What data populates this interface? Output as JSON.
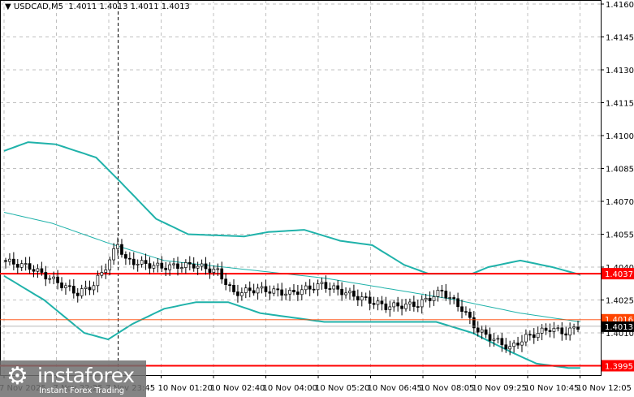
{
  "header": {
    "symbol": "USDCAD,M5",
    "ohlc": "1.4011 1.4013 1.4011 1.4013"
  },
  "watermark": {
    "brand": "instaforex",
    "tagline": "Instant Forex Trading"
  },
  "chart_data": {
    "type": "candlestick",
    "title": "USDCAD,M5",
    "ylim": [
      1.399,
      1.416
    ],
    "yticks": [
      "1.4160",
      "1.4145",
      "1.4130",
      "1.4115",
      "1.4100",
      "1.4085",
      "1.4070",
      "1.4055",
      "1.4040",
      "1.4025",
      "1.4010"
    ],
    "xticks": [
      "7 Nov 2025",
      "7 Nov 22:25",
      "7 Nov 23:45",
      "10 Nov 01:20",
      "10 Nov 02:40",
      "10 Nov 04:00",
      "10 Nov 05:20",
      "10 Nov 06:45",
      "10 Nov 08:05",
      "10 Nov 09:25",
      "10 Nov 10:45",
      "10 Nov 12:05"
    ],
    "bars": 144,
    "price": [
      [
        0,
        1.4043
      ],
      [
        7,
        1.404
      ],
      [
        17,
        1.403
      ],
      [
        19,
        1.4028
      ],
      [
        23,
        1.4032
      ],
      [
        27,
        1.4043
      ],
      [
        29,
        1.4051
      ],
      [
        31,
        1.4043
      ],
      [
        40,
        1.404
      ],
      [
        48,
        1.4041
      ],
      [
        54,
        1.4038
      ],
      [
        58,
        1.4028
      ],
      [
        64,
        1.403
      ],
      [
        72,
        1.4028
      ],
      [
        80,
        1.4032
      ],
      [
        88,
        1.4027
      ],
      [
        96,
        1.4022
      ],
      [
        104,
        1.4023
      ],
      [
        110,
        1.4029
      ],
      [
        115,
        1.4021
      ],
      [
        119,
        1.4011
      ],
      [
        127,
        1.4003
      ],
      [
        131,
        1.4008
      ],
      [
        137,
        1.4012
      ],
      [
        141,
        1.401
      ],
      [
        144,
        1.4013
      ]
    ],
    "upper_band": [
      [
        0,
        1.4093
      ],
      [
        6,
        1.4097
      ],
      [
        13,
        1.4096
      ],
      [
        23,
        1.409
      ],
      [
        29,
        1.4079
      ],
      [
        38,
        1.4062
      ],
      [
        46,
        1.4055
      ],
      [
        60,
        1.4054
      ],
      [
        66,
        1.4056
      ],
      [
        75,
        1.4057
      ],
      [
        84,
        1.4052
      ],
      [
        92,
        1.405
      ],
      [
        100,
        1.4041
      ],
      [
        106,
        1.4037
      ],
      [
        117,
        1.4037
      ],
      [
        121,
        1.404
      ],
      [
        129,
        1.4043
      ],
      [
        137,
        1.404
      ],
      [
        145,
        1.4036
      ]
    ],
    "middle_band": [
      [
        0,
        1.4065
      ],
      [
        12,
        1.406
      ],
      [
        26,
        1.4051
      ],
      [
        40,
        1.4043
      ],
      [
        60,
        1.4039
      ],
      [
        80,
        1.4035
      ],
      [
        100,
        1.4029
      ],
      [
        113,
        1.4025
      ],
      [
        129,
        1.4019
      ],
      [
        144,
        1.4015
      ]
    ],
    "lower_band": [
      [
        0,
        1.4036
      ],
      [
        10,
        1.4025
      ],
      [
        20,
        1.401
      ],
      [
        26,
        1.4007
      ],
      [
        32,
        1.4014
      ],
      [
        40,
        1.4021
      ],
      [
        48,
        1.4024
      ],
      [
        56,
        1.4024
      ],
      [
        64,
        1.4019
      ],
      [
        80,
        1.4015
      ],
      [
        92,
        1.4015
      ],
      [
        108,
        1.4015
      ],
      [
        117,
        1.401
      ],
      [
        127,
        1.4001
      ],
      [
        133,
        1.3996
      ],
      [
        141,
        1.3994
      ]
    ],
    "vline_bar": 28.5,
    "levels": [
      {
        "value": "1.4037",
        "color": "#ff0000"
      },
      {
        "value": "1.3995",
        "color": "#ff0000"
      }
    ],
    "current": {
      "bid": "1.4013",
      "ask": "1.4016"
    },
    "colors": {
      "band": "#20b2aa",
      "level": "#ff0000",
      "ask": "#ff4500"
    }
  }
}
